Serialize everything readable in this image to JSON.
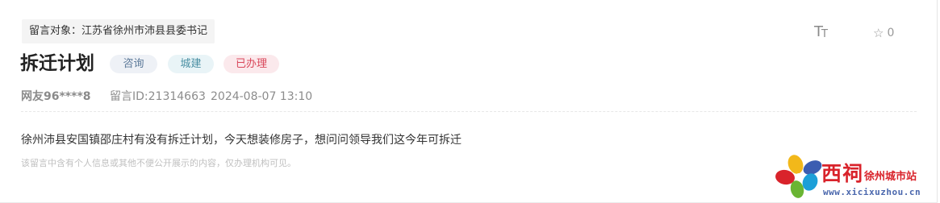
{
  "message": {
    "target_label": "留言对象：江苏省徐州市沛县县委书记",
    "title": "拆迁计划",
    "tags": [
      "咨询",
      "城建",
      "已办理"
    ],
    "user": "网友96****8",
    "message_id": "留言ID:21314663",
    "date": "2024-08-07 13:10",
    "content": "徐州沛县安国镇邵庄村有没有拆迁计划，今天想装修房子，想问问领导我们这今年可拆迁",
    "privacy_note": "该留言中含有个人信息或其他不便公开展示的内容，仅办理机构可见。"
  },
  "toolbar": {
    "font_icon_big": "T",
    "font_icon_small": "T",
    "favorite_icon": "star-outline-icon",
    "favorite_count": "0"
  },
  "logo": {
    "cn_name": "西祠",
    "site_name": "徐州城市站",
    "url": "www.xicixuzhou.cn"
  }
}
